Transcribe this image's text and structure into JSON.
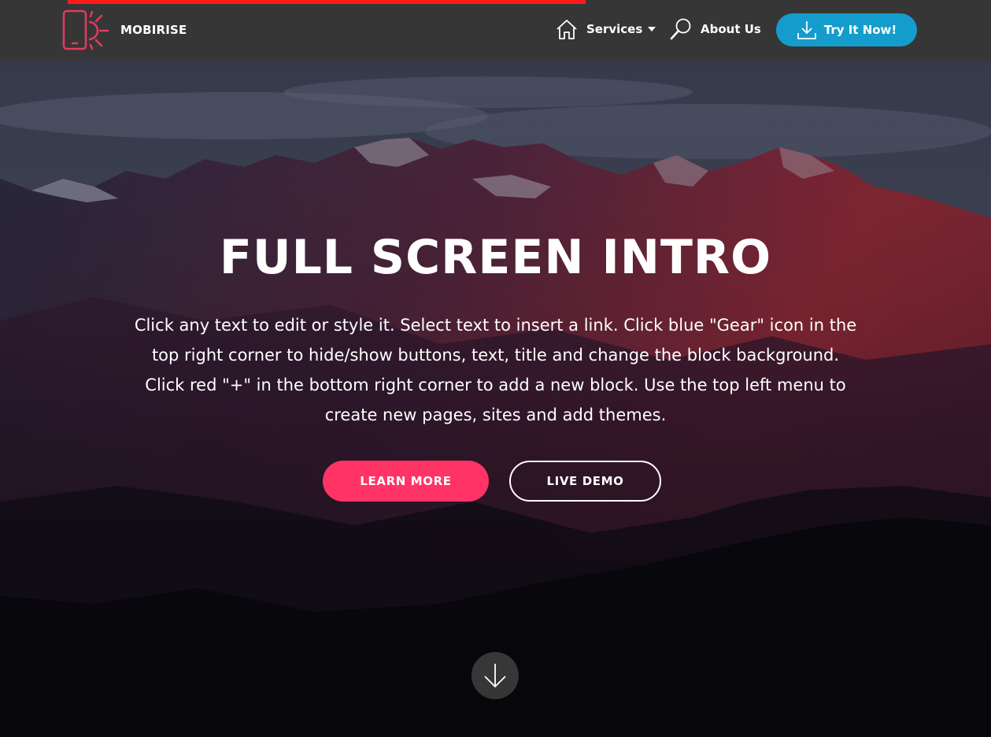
{
  "navbar": {
    "brand_name": "MOBIRISE",
    "logo_icon": "mobile-phone-sun-icon",
    "items": [
      {
        "label": "Services",
        "icon": "home-icon",
        "has_dropdown": true
      },
      {
        "label": "About Us",
        "icon": "search-icon",
        "has_dropdown": false
      }
    ],
    "cta_label": "Try It Now!",
    "cta_icon": "download-icon"
  },
  "hero": {
    "title": "FULL SCREEN INTRO",
    "text": "Click any text to edit or style it. Select text to insert a link. Click blue \"Gear\" icon in the top right corner to hide/show buttons, text, title and change the block background. Click red \"+\" in the bottom right corner to add a new block. Use the top left menu to create new pages, sites and add themes.",
    "buttons": {
      "primary_label": "LEARN MORE",
      "secondary_label": "LIVE DEMO"
    },
    "scroll_icon": "arrow-down-icon"
  },
  "colors": {
    "navbar_bg": "#363636",
    "accent_pink": "#ff3366",
    "accent_blue": "#149dcc",
    "logo_pink": "#e8395f",
    "progress_red": "#ff1a1a"
  }
}
